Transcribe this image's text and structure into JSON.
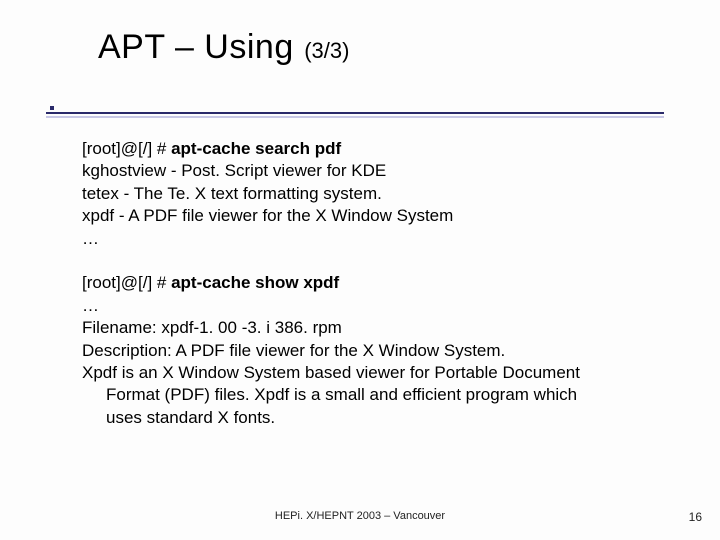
{
  "title": "APT – Using",
  "title_count": "(3/3)",
  "block1": {
    "prompt": "[root]@[/] # ",
    "cmd": "apt-cache search pdf",
    "l1": "kghostview - Post. Script viewer for KDE",
    "l2": "tetex - The Te. X text formatting system.",
    "l3": "xpdf - A PDF file viewer for the X Window System",
    "l4": "…"
  },
  "block2": {
    "prompt": "[root]@[/] # ",
    "cmd": "apt-cache show xpdf",
    "l1": "…",
    "l2": "Filename: xpdf-1. 00 -3. i 386. rpm",
    "l3": "Description: A PDF file viewer for the X Window System.",
    "l4": "Xpdf is an X Window System based viewer for Portable Document",
    "l5": "Format (PDF) files. Xpdf is a small and efficient program which",
    "l6": "uses standard X fonts."
  },
  "footer": "HEPi. X/HEPNT 2003 – Vancouver",
  "page_number": "16"
}
